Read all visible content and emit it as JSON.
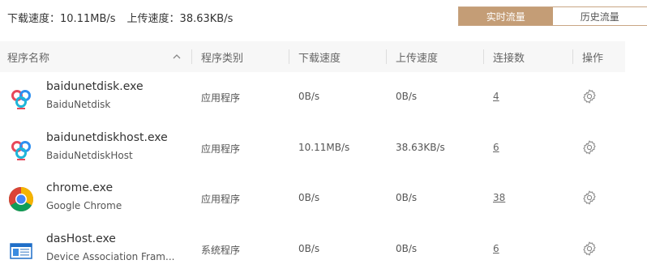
{
  "summary": {
    "download_label": "下载速度：",
    "download_value": "10.11MB/s",
    "upload_label": "上传速度：",
    "upload_value": "38.63KB/s"
  },
  "tabs": [
    {
      "label": "实时流量",
      "active": true
    },
    {
      "label": "历史流量",
      "active": false
    }
  ],
  "columns": {
    "name": "程序名称",
    "type": "程序类别",
    "download": "下载速度",
    "upload": "上传速度",
    "connections": "连接数",
    "actions": "操作"
  },
  "rows": [
    {
      "name": "baidunetdisk.exe",
      "sub": "BaiduNetdisk",
      "icon": "baidunetdisk-icon",
      "type": "应用程序",
      "download": "0B/s",
      "upload": "0B/s",
      "connections": "4"
    },
    {
      "name": "baidunetdiskhost.exe",
      "sub": "BaiduNetdiskHost",
      "icon": "baidunetdisk-icon",
      "type": "应用程序",
      "download": "10.11MB/s",
      "upload": "38.63KB/s",
      "connections": "6"
    },
    {
      "name": "chrome.exe",
      "sub": "Google Chrome",
      "icon": "chrome-icon",
      "type": "应用程序",
      "download": "0B/s",
      "upload": "0B/s",
      "connections": "38"
    },
    {
      "name": "dasHost.exe",
      "sub": "Device Association Fram...",
      "icon": "window-app-icon",
      "type": "系统程序",
      "download": "0B/s",
      "upload": "0B/s",
      "connections": "6"
    }
  ],
  "colors": {
    "accent": "#c49d76",
    "header_bg": "#f7f7f7"
  }
}
